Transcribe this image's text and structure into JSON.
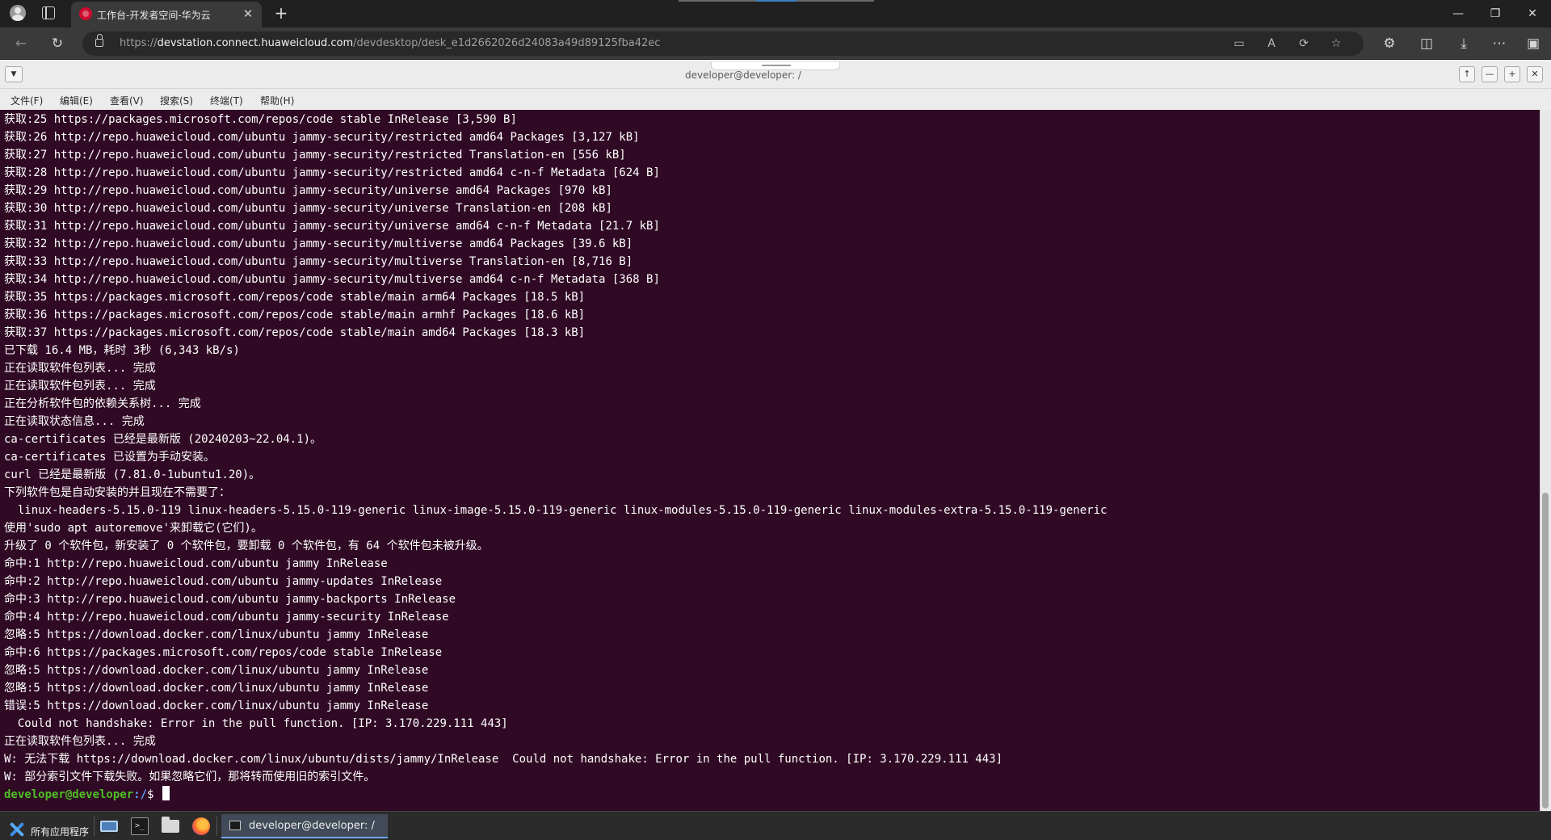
{
  "browser": {
    "tab_title": "工作台-开发者空间-华为云",
    "tab_close": "✕",
    "new_tab": "+",
    "url_prefix": "https://",
    "url_domain": "devstation.connect.huaweicloud.com",
    "url_path": "/devdesktop/desk_e1d2662026d24083a49d89125fba42ec",
    "icons": [
      "profile-avatar-icon",
      "tab-actions-icon",
      "back-icon",
      "refresh-icon",
      "lock-icon",
      "app-available-icon",
      "read-aloud-icon",
      "translate-icon",
      "favorite-star-icon",
      "extensions-icon",
      "split-screen-icon",
      "downloads-icon",
      "more-icon",
      "sidebar-icon"
    ],
    "window_controls": {
      "minimize": "—",
      "restore": "❐",
      "close": "✕"
    }
  },
  "terminal": {
    "window_title": "developer@developer: /",
    "menu": [
      "文件(F)",
      "编辑(E)",
      "查看(V)",
      "搜索(S)",
      "终端(T)",
      "帮助(H)"
    ],
    "lines": [
      "获取:25 https://packages.microsoft.com/repos/code stable InRelease [3,590 B]",
      "获取:26 http://repo.huaweicloud.com/ubuntu jammy-security/restricted amd64 Packages [3,127 kB]",
      "获取:27 http://repo.huaweicloud.com/ubuntu jammy-security/restricted Translation-en [556 kB]",
      "获取:28 http://repo.huaweicloud.com/ubuntu jammy-security/restricted amd64 c-n-f Metadata [624 B]",
      "获取:29 http://repo.huaweicloud.com/ubuntu jammy-security/universe amd64 Packages [970 kB]",
      "获取:30 http://repo.huaweicloud.com/ubuntu jammy-security/universe Translation-en [208 kB]",
      "获取:31 http://repo.huaweicloud.com/ubuntu jammy-security/universe amd64 c-n-f Metadata [21.7 kB]",
      "获取:32 http://repo.huaweicloud.com/ubuntu jammy-security/multiverse amd64 Packages [39.6 kB]",
      "获取:33 http://repo.huaweicloud.com/ubuntu jammy-security/multiverse Translation-en [8,716 B]",
      "获取:34 http://repo.huaweicloud.com/ubuntu jammy-security/multiverse amd64 c-n-f Metadata [368 B]",
      "获取:35 https://packages.microsoft.com/repos/code stable/main arm64 Packages [18.5 kB]",
      "获取:36 https://packages.microsoft.com/repos/code stable/main armhf Packages [18.6 kB]",
      "获取:37 https://packages.microsoft.com/repos/code stable/main amd64 Packages [18.3 kB]",
      "已下载 16.4 MB，耗时 3秒 (6,343 kB/s)",
      "正在读取软件包列表... 完成",
      "正在读取软件包列表... 完成",
      "正在分析软件包的依赖关系树... 完成",
      "正在读取状态信息... 完成",
      "ca-certificates 已经是最新版 (20240203~22.04.1)。",
      "ca-certificates 已设置为手动安装。",
      "curl 已经是最新版 (7.81.0-1ubuntu1.20)。",
      "下列软件包是自动安装的并且现在不需要了：",
      "  linux-headers-5.15.0-119 linux-headers-5.15.0-119-generic linux-image-5.15.0-119-generic linux-modules-5.15.0-119-generic linux-modules-extra-5.15.0-119-generic",
      "使用'sudo apt autoremove'来卸载它(它们)。",
      "升级了 0 个软件包，新安装了 0 个软件包，要卸载 0 个软件包，有 64 个软件包未被升级。",
      "命中:1 http://repo.huaweicloud.com/ubuntu jammy InRelease",
      "命中:2 http://repo.huaweicloud.com/ubuntu jammy-updates InRelease",
      "命中:3 http://repo.huaweicloud.com/ubuntu jammy-backports InRelease",
      "命中:4 http://repo.huaweicloud.com/ubuntu jammy-security InRelease",
      "忽略:5 https://download.docker.com/linux/ubuntu jammy InRelease",
      "命中:6 https://packages.microsoft.com/repos/code stable InRelease",
      "忽略:5 https://download.docker.com/linux/ubuntu jammy InRelease",
      "忽略:5 https://download.docker.com/linux/ubuntu jammy InRelease",
      "错误:5 https://download.docker.com/linux/ubuntu jammy InRelease",
      "  Could not handshake: Error in the pull function. [IP: 3.170.229.111 443]",
      "正在读取软件包列表... 完成",
      "W: 无法下载 https://download.docker.com/linux/ubuntu/dists/jammy/InRelease  Could not handshake: Error in the pull function. [IP: 3.170.229.111 443]",
      "W: 部分索引文件下载失败。如果忽略它们，那将转而使用旧的索引文件。"
    ],
    "prompt_user": "developer@developer",
    "prompt_path": ":/",
    "prompt_symbol": "$ ",
    "colors": {
      "background": "#300a24",
      "text": "#ffffff",
      "prompt_user": "#4fbf26",
      "prompt_path": "#5ea0ff"
    },
    "scroll_position": 1.0,
    "scroll_visible_fraction": 0.45
  },
  "taskbar": {
    "apps_label": "所有应用程序",
    "active_task_label": "developer@developer: /",
    "term_glyph": ">_"
  }
}
